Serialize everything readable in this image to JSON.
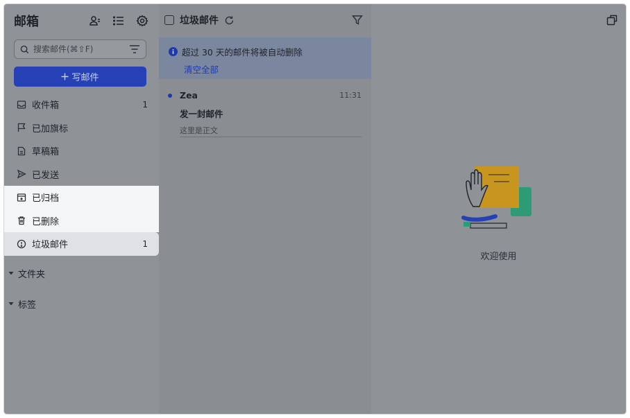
{
  "sidebar": {
    "title": "邮箱",
    "search": {
      "placeholder": "搜索邮件(⌘⇧F)"
    },
    "compose_label": "写邮件",
    "items": [
      {
        "label": "收件箱",
        "count": "1",
        "icon": "inbox-icon"
      },
      {
        "label": "已加旗标",
        "count": "",
        "icon": "flag-icon"
      },
      {
        "label": "草稿箱",
        "count": "",
        "icon": "draft-icon"
      },
      {
        "label": "已发送",
        "count": "",
        "icon": "send-icon"
      },
      {
        "label": "已归档",
        "count": "",
        "icon": "archive-icon"
      },
      {
        "label": "已删除",
        "count": "",
        "icon": "trash-icon"
      },
      {
        "label": "垃圾邮件",
        "count": "1",
        "icon": "spam-icon"
      }
    ],
    "groups": [
      {
        "label": "文件夹"
      },
      {
        "label": "标签"
      }
    ]
  },
  "list": {
    "title": "垃圾邮件",
    "banner": {
      "text": "超过 30 天的邮件将被自动删除",
      "link": "清空全部"
    },
    "messages": [
      {
        "sender": "Zea",
        "time": "11:31",
        "subject": "发一封邮件",
        "preview": "这里是正文"
      }
    ]
  },
  "reader": {
    "welcome_text": "欢迎使用"
  },
  "colors": {
    "accent": "#2641b6",
    "link": "#1d3bb5",
    "illustration_yellow": "#c8951e",
    "illustration_green": "#2d9b73"
  }
}
